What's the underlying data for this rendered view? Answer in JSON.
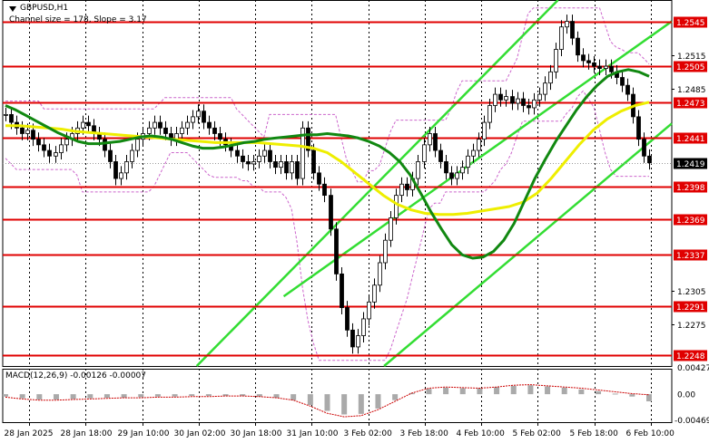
{
  "chart_data": {
    "type": "line",
    "symbol": "GBPUSD,H1",
    "subtitle": "Channel size = 178, Slope = 3.17",
    "x_ticks": [
      "28 Jan 2025",
      "28 Jan 18:00",
      "29 Jan 10:00",
      "30 Jan 02:00",
      "30 Jan 18:00",
      "31 Jan 10:00",
      "3 Feb 02:00",
      "3 Feb 18:00",
      "4 Feb 10:00",
      "5 Feb 02:00",
      "5 Feb 18:00",
      "6 Feb 10:00"
    ],
    "price_axis_ticks": [
      1.2515,
      1.2485,
      1.2305,
      1.2275
    ],
    "ylim": [
      1.2238,
      1.2564
    ],
    "current_price": 1.2419,
    "level_lines": [
      1.2545,
      1.2505,
      1.2473,
      1.2441,
      1.2398,
      1.2369,
      1.2337,
      1.2291,
      1.2248
    ],
    "colors": {
      "levels": "#e00000",
      "channel": "#33dd33",
      "ma_fast": "#118811",
      "ma_slow": "#eeee00",
      "bands": "#cc66cc",
      "candles": "#000000",
      "current_price_label": "#000000",
      "macd_line": "#cc0000",
      "macd_hist": "#aaaaaa"
    },
    "price_series": {
      "name": "GBPUSD H1 close",
      "values": [
        1.2462,
        1.2455,
        1.245,
        1.2445,
        1.2448,
        1.244,
        1.2435,
        1.243,
        1.2425,
        1.2428,
        1.2435,
        1.244,
        1.2445,
        1.245,
        1.2455,
        1.2452,
        1.2445,
        1.244,
        1.243,
        1.242,
        1.2405,
        1.241,
        1.242,
        1.243,
        1.244,
        1.2445,
        1.245,
        1.2455,
        1.245,
        1.2445,
        1.244,
        1.2445,
        1.245,
        1.2455,
        1.246,
        1.2465,
        1.2455,
        1.245,
        1.2445,
        1.244,
        1.2435,
        1.243,
        1.2425,
        1.242,
        1.2418,
        1.242,
        1.2425,
        1.243,
        1.242,
        1.2415,
        1.242,
        1.241,
        1.242,
        1.2405,
        1.245,
        1.243,
        1.241,
        1.24,
        1.239,
        1.236,
        1.232,
        1.229,
        1.227,
        1.2255,
        1.2265,
        1.228,
        1.2295,
        1.231,
        1.233,
        1.235,
        1.237,
        1.239,
        1.24,
        1.2395,
        1.2405,
        1.242,
        1.2435,
        1.2445,
        1.243,
        1.242,
        1.241,
        1.2405,
        1.241,
        1.2415,
        1.2425,
        1.243,
        1.244,
        1.2455,
        1.247,
        1.248,
        1.2475,
        1.2478,
        1.2472,
        1.2476,
        1.247,
        1.2468,
        1.2475,
        1.248,
        1.249,
        1.25,
        1.252,
        1.254,
        1.2545,
        1.253,
        1.2515,
        1.251,
        1.2508,
        1.2505,
        1.2503,
        1.2505,
        1.25,
        1.2495,
        1.2488,
        1.248,
        1.246,
        1.244,
        1.2425,
        1.2419
      ]
    },
    "ma_fast": {
      "values": [
        1.247,
        1.2466,
        1.2461,
        1.2456,
        1.2451,
        1.2446,
        1.2442,
        1.2438,
        1.2436,
        1.2436,
        1.2437,
        1.2438,
        1.244,
        1.2442,
        1.2443,
        1.2442,
        1.244,
        1.2437,
        1.2434,
        1.2432,
        1.2432,
        1.2433,
        1.2435,
        1.2437,
        1.2438,
        1.244,
        1.2441,
        1.2442,
        1.2443,
        1.2444,
        1.2444,
        1.2445,
        1.2444,
        1.2443,
        1.2441,
        1.2438,
        1.2434,
        1.2428,
        1.242,
        1.2408,
        1.2392,
        1.2375,
        1.236,
        1.2346,
        1.2337,
        1.2334,
        1.2335,
        1.234,
        1.235,
        1.2365,
        1.2385,
        1.2405,
        1.2422,
        1.2438,
        1.2452,
        1.2466,
        1.2478,
        1.2488,
        1.2496,
        1.25,
        1.2502,
        1.25,
        1.2496
      ]
    },
    "ma_slow": {
      "values": [
        1.2452,
        1.2452,
        1.2451,
        1.245,
        1.2449,
        1.2447,
        1.2446,
        1.2445,
        1.2444,
        1.2443,
        1.2442,
        1.2441,
        1.244,
        1.2439,
        1.2438,
        1.2437,
        1.2437,
        1.2437,
        1.2437,
        1.2436,
        1.2435,
        1.2434,
        1.2432,
        1.2428,
        1.242,
        1.241,
        1.24,
        1.239,
        1.2382,
        1.2377,
        1.2374,
        1.2373,
        1.2373,
        1.2374,
        1.2376,
        1.2378,
        1.238,
        1.2384,
        1.2392,
        1.2405,
        1.242,
        1.2435,
        1.2448,
        1.2458,
        1.2465,
        1.247,
        1.2473
      ]
    },
    "channel_lines": [
      {
        "x0": 0.29,
        "y0": 1.2238,
        "x1": 0.83,
        "y1": 1.2564
      },
      {
        "x0": 0.57,
        "y0": 1.2238,
        "x1": 1.0,
        "y1": 1.2454
      },
      {
        "x0": 0.42,
        "y0": 1.23,
        "x1": 1.0,
        "y1": 1.2545
      }
    ],
    "macd": {
      "label": "MACD(12,26,9) -0.00126 -0.00007",
      "axis_ticks": [
        "0.00",
        "-0.00469"
      ],
      "top_tick": "0.00427",
      "ylim": [
        -0.00469,
        0.00427
      ],
      "signal": [
        -0.0005,
        -0.0008,
        -0.001,
        -0.001,
        -0.0009,
        -0.0008,
        -0.0007,
        -0.0006,
        -0.0006,
        -0.0005,
        -0.0005,
        -0.0004,
        -0.0004,
        -0.0003,
        -0.0003,
        -0.0004,
        -0.0006,
        -0.001,
        -0.002,
        -0.0032,
        -0.0038,
        -0.0036,
        -0.0026,
        -0.0012,
        0.0002,
        0.001,
        0.0012,
        0.0011,
        0.001,
        0.0012,
        0.0015,
        0.0016,
        0.0014,
        0.0012,
        0.001,
        0.0007,
        0.0004,
        0.0001,
        -0.0001
      ],
      "histogram": [
        -0.0004,
        -0.0007,
        -0.0009,
        -0.0009,
        -0.0008,
        -0.0007,
        -0.0006,
        -0.0006,
        -0.0005,
        -0.0004,
        -0.0004,
        -0.0003,
        -0.0003,
        -0.0003,
        -0.0003,
        -0.0004,
        -0.0006,
        -0.001,
        -0.0018,
        -0.0028,
        -0.0034,
        -0.0033,
        -0.0024,
        -0.001,
        0.0002,
        0.0009,
        0.0011,
        0.001,
        0.001,
        0.0012,
        0.0014,
        0.0015,
        0.0013,
        0.0011,
        0.0008,
        0.0005,
        0.0001,
        -0.0004,
        -0.0012
      ]
    }
  }
}
